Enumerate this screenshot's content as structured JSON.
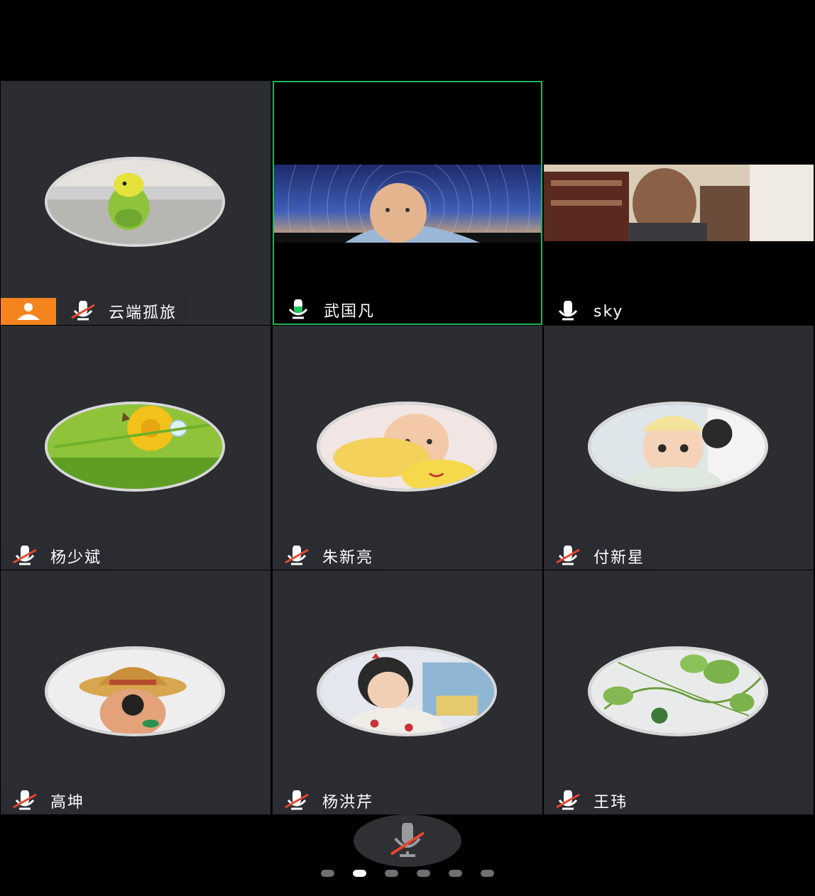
{
  "participants": [
    {
      "name": "云端孤旅",
      "mic": "muted",
      "host": true,
      "video": false,
      "avatar": "parrot-avatar"
    },
    {
      "name": "武国凡",
      "mic": "speaking",
      "host": false,
      "video": true,
      "active_speaker": true
    },
    {
      "name": "sky",
      "mic": "on",
      "host": false,
      "video": true
    },
    {
      "name": "杨少斌",
      "mic": "muted",
      "host": false,
      "video": false,
      "avatar": "dandelion-avatar"
    },
    {
      "name": "朱新亮",
      "mic": "muted",
      "host": false,
      "video": false,
      "avatar": "baby-avatar"
    },
    {
      "name": "付新星",
      "mic": "muted",
      "host": false,
      "video": false,
      "avatar": "baby-hat-avatar"
    },
    {
      "name": "高坤",
      "mic": "muted",
      "host": false,
      "video": false,
      "avatar": "toy-figure-avatar"
    },
    {
      "name": "杨洪芹",
      "mic": "muted",
      "host": false,
      "video": false,
      "avatar": "child-avatar"
    },
    {
      "name": "王玮",
      "mic": "muted",
      "host": false,
      "video": false,
      "avatar": "watermelon-vine-avatar"
    }
  ],
  "controls": {
    "mute_button_icon": "mic-muted-icon"
  },
  "pagination": {
    "pages": 6,
    "current": 2
  },
  "colors": {
    "tile_bg": "#2b2d31",
    "active_border": "#22b35c",
    "host_badge": "#f5841f",
    "muted_slash": "#e8462f",
    "speaking": "#22c55e"
  }
}
